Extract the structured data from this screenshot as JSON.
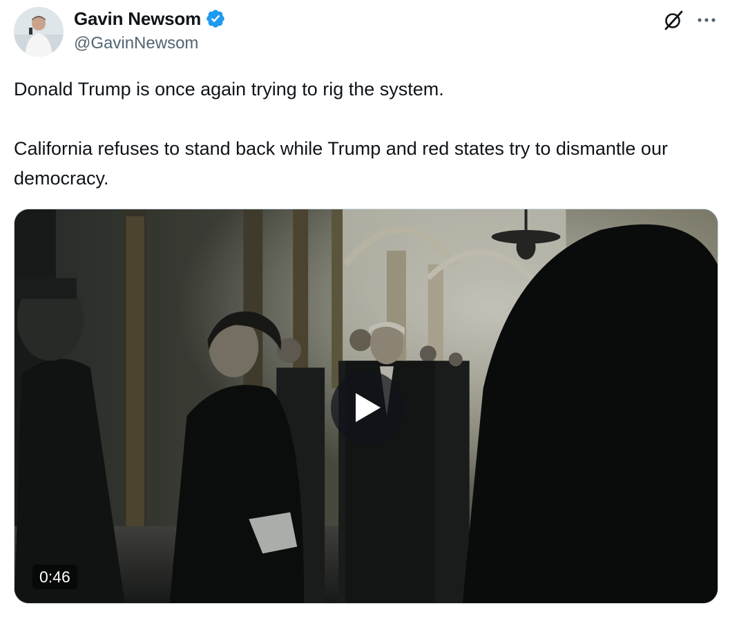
{
  "author": {
    "name": "Gavin Newsom",
    "handle": "@GavinNewsom",
    "verified": true,
    "verified_color": "#1d9bf0",
    "avatar_icon": "profile-photo"
  },
  "header_actions": {
    "grok_icon": "grok-icon",
    "more_icon": "more-icon"
  },
  "tweet": {
    "paragraph_1": "Donald Trump is once again trying to rig the system.",
    "paragraph_2": "California refuses to stand back while Trump and red states try to dismantle our democracy."
  },
  "media": {
    "type": "video",
    "duration": "0:46",
    "play_icon": "play-icon"
  }
}
